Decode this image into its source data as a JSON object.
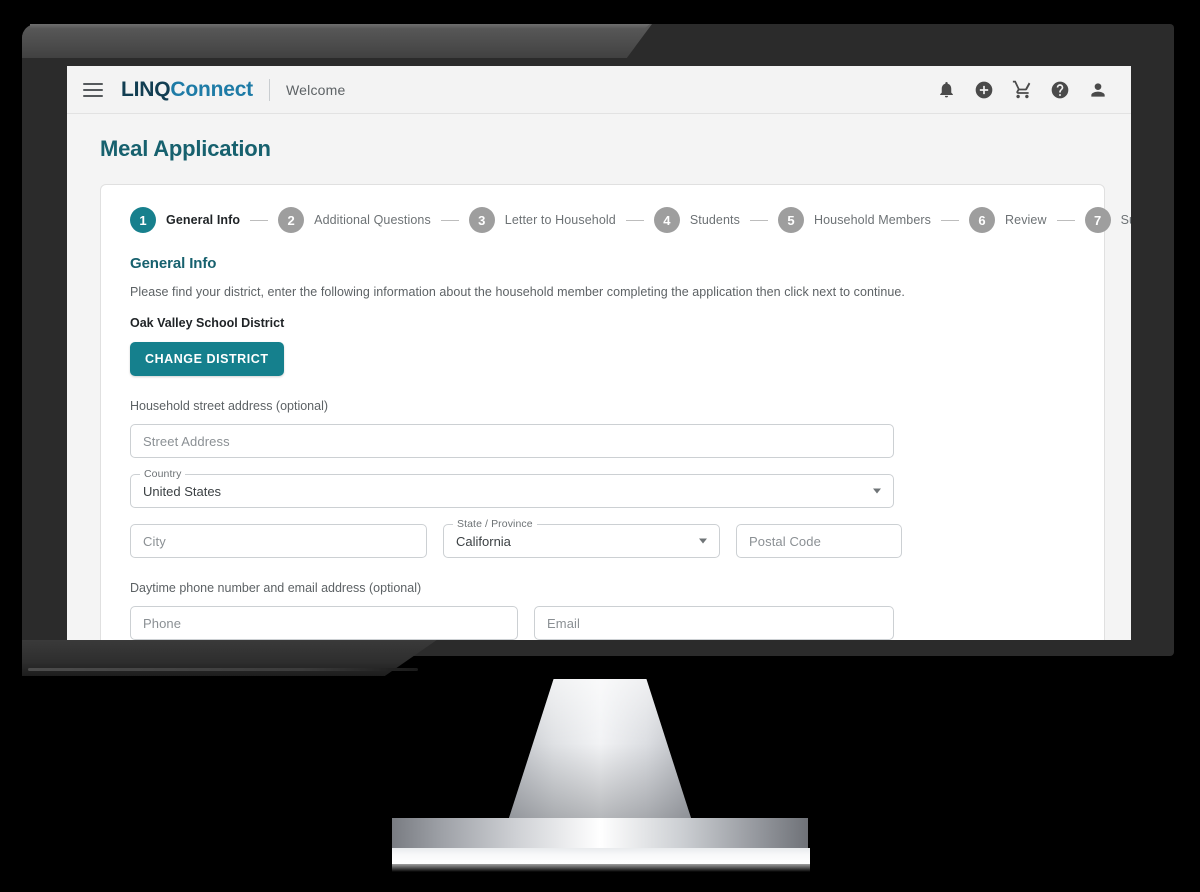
{
  "appbar": {
    "menu_icon": "hamburger-menu-icon",
    "brand_primary": "LINQ",
    "brand_secondary": "Connect",
    "welcome": "Welcome",
    "icons": [
      {
        "name": "notifications-bell-icon",
        "label": "Notifications"
      },
      {
        "name": "add-circle-icon",
        "label": "Add"
      },
      {
        "name": "shopping-cart-icon",
        "label": "Cart"
      },
      {
        "name": "help-circle-icon",
        "label": "Help"
      },
      {
        "name": "account-person-icon",
        "label": "Account"
      }
    ]
  },
  "page": {
    "title": "Meal Application"
  },
  "stepper": {
    "steps": [
      {
        "number": "1",
        "label": "General Info",
        "active": true
      },
      {
        "number": "2",
        "label": "Additional Questions",
        "active": false
      },
      {
        "number": "3",
        "label": "Letter to Household",
        "active": false
      },
      {
        "number": "4",
        "label": "Students",
        "active": false
      },
      {
        "number": "5",
        "label": "Household Members",
        "active": false
      },
      {
        "number": "6",
        "label": "Review",
        "active": false
      },
      {
        "number": "7",
        "label": "Submit",
        "active": false
      }
    ]
  },
  "general_info": {
    "section_title": "General Info",
    "description": "Please find your district, enter the following information about the household member completing the application then click next to continue.",
    "district_name": "Oak Valley School District",
    "change_district_button": "CHANGE DISTRICT",
    "address_label": "Household street address (optional)",
    "street_placeholder": "Street Address",
    "country_label": "Country",
    "country_value": "United States",
    "city_placeholder": "City",
    "state_label": "State / Province",
    "state_value": "California",
    "postal_placeholder": "Postal Code",
    "contact_label": "Daytime phone number and email address (optional)",
    "phone_placeholder": "Phone",
    "email_placeholder": "Email"
  },
  "colors": {
    "accent_teal": "#17808d",
    "brand_dark": "#123e52",
    "brand_blue": "#1e7ba6",
    "title_teal": "#17616e",
    "step_inactive": "#9e9e9e",
    "bezel": "#2b2b2b",
    "background": "#000000"
  }
}
